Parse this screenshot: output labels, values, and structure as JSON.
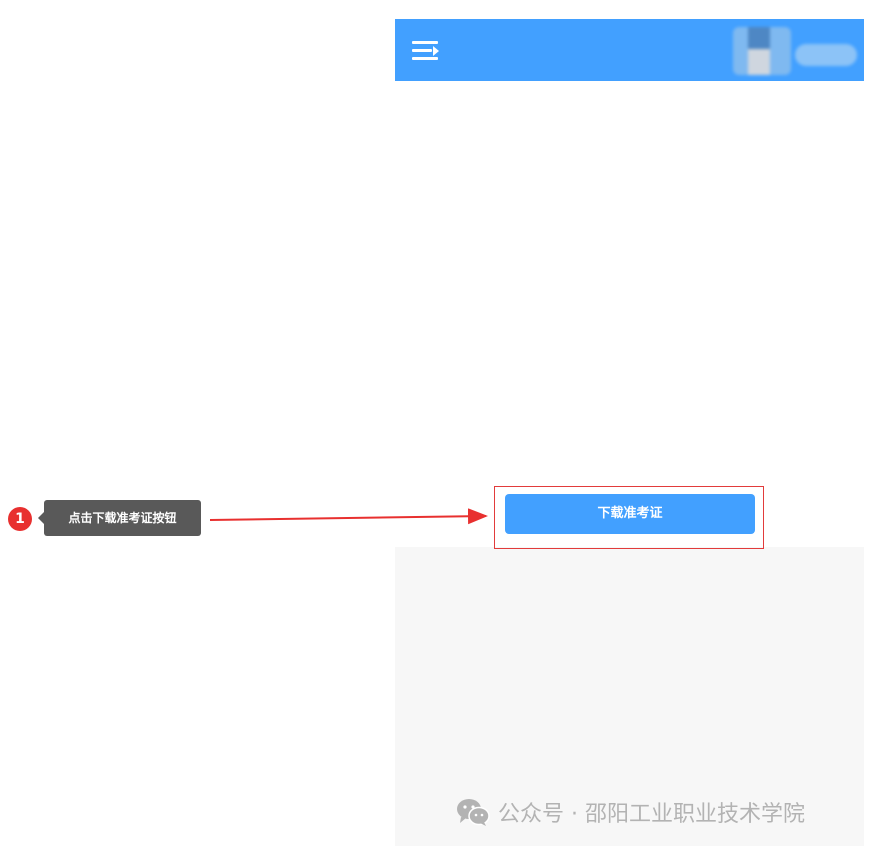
{
  "topbar": {
    "menu_icon": "menu-icon",
    "avatar": "blurred-avatar",
    "username": ""
  },
  "main": {
    "download_button_label": "下载准考证"
  },
  "annotation": {
    "step_number": "1",
    "callout_text": "点击下载准考证按钮",
    "accent_color": "#e8302f"
  },
  "watermark": {
    "text": "公众号 · 邵阳工业职业技术学院",
    "icon": "wechat-icon"
  },
  "colors": {
    "primary": "#42a0ff",
    "panel": "#f7f7f7",
    "highlight": "#e23b3b"
  }
}
